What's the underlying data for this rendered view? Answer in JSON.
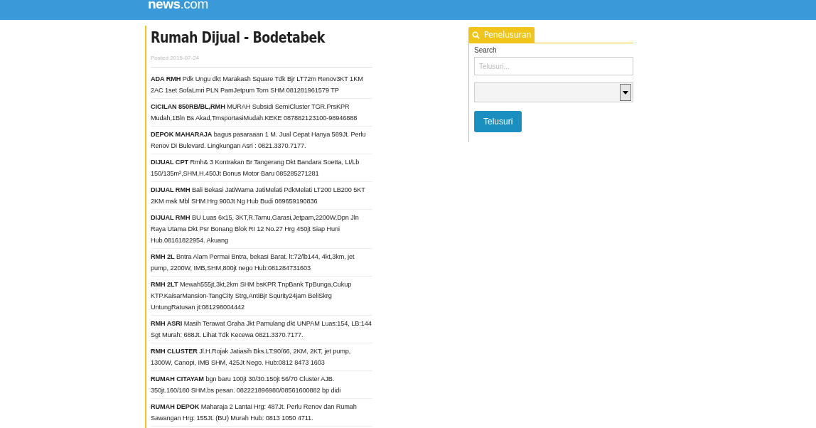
{
  "header": {
    "logo": {
      "name": "news",
      "suffix": ".com"
    }
  },
  "article": {
    "title": "Rumah Dijual - Bodetabek",
    "posted": "Posted 2015-07-24",
    "listings": [
      "**ADA RMH** Pdk Ungu dkt Marakash Square Tdk Bjr LT72m Renov3KT 1KM 2AC 1set SofaLmri PLN PamJetpum Torn SHM 081281961579 TP",
      "**CICILAN 850RB/BL,RMH** MURAH Subsidi SemiCluster TGR.PrsKPR Mudah,1Bln Bs Akad,TrnsportasiMudah.KEKE 087882123100-98946888",
      "**DEPOK MAHARAJA** bagus pasaraaan 1 M. Jual Cepat Hanya 589Jt. Perlu Renov Di Bulevard. Lingkungan Asri : 0821.3370.7177.",
      "**DIJUAL CPT** Rmh& 3 Kontrakan Br Tangerang Dkt Bandara Soetta, Lt/Lb 150/135m²,SHM,H.450Jt Bonus Motor Baru 085285271281",
      "**DIJUAL RMH** Bali Bekasi JatiWarna JatiMelati PdkMelati LT200 LB200 5KT 2KM msk Mbl SHM Hrg 900Jt Ng Hub Budi 089659190836",
      "**DIJUAL RMH** BU Luas 6x15, 3KT,R.Tamu,Garasi,Jetpam,2200W,Dpn Jln Raya Utama Dkt Psr Bonang Blok RI 12 No.27 Hrg 450jt Siap Huni Hub.08161822954. Akuang",
      "**RMH 2L** Bntra Alam Permai Bntra, bekasi Barat. lt:72/lb144, 4kt,3km, jet pump, 2200W, IMB,SHM,800jt nego Hub:081284731603",
      "**RMH 2LT** Mewah555jt,3kt,2km SHM bsKPR TnpBank TpBunga,Cukup KTP.KaisarMansion-TangCity Strg,AntiBjr Squrity24jam BeliSkrg UntungRatusan jt:081298004442",
      "**RMH ASRI** Masih Terawat Graha Jkt Pamulang dkt UNPAM Luas:154, LB:144 Sgt Murah: 688Jt. Lihat Tdk Kecewa 0821.3370.7177.",
      "**RMH CLUSTER** Jl.H.Rojak Jatiasih Bks.LT:90/66, 2KM, 2KT, jet pump, 1300W, Canopi, IMB SHM, 425Jt Nego. Hub:0812 8473 1603",
      "**RUMAH CITAYAM** bgn baru 100jt 30/30.150jt 56/70 Cluster AJB. 350jt.160/180 SHM.bs pesan. 082221896980/08561600882 bp didi",
      "**RUMAH DEPOK** Maharaja 2 Lantai Hrg: 487Jt. Perlu Renov dan Rumah Sawangan Hrg: 155Jt. (BU) Murah Hub: 0813 1050 4711."
    ]
  },
  "sidebar": {
    "tab": "Penelusuran",
    "search_label": "Search",
    "search_field": {
      "placeholder": "Telusuri..."
    },
    "button": "Telusuri"
  }
}
